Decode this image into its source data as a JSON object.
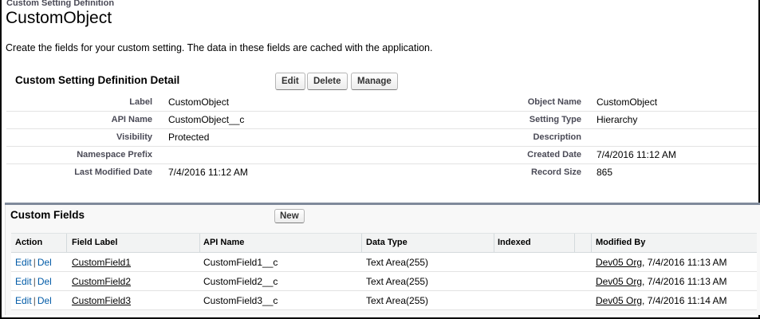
{
  "breadcrumb": "Custom Setting Definition",
  "title": "CustomObject",
  "description": "Create the fields for your custom setting. The data in these fields are cached with the application.",
  "detail": {
    "header": "Custom Setting Definition Detail",
    "buttons": {
      "edit": "Edit",
      "delete": "Delete",
      "manage": "Manage"
    },
    "rows": [
      {
        "label1": "Label",
        "value1": "CustomObject",
        "label2": "Object Name",
        "value2": "CustomObject"
      },
      {
        "label1": "API Name",
        "value1": "CustomObject__c",
        "label2": "Setting Type",
        "value2": "Hierarchy"
      },
      {
        "label1": "Visibility",
        "value1": "Protected",
        "label2": "Description",
        "value2": ""
      },
      {
        "label1": "Namespace Prefix",
        "value1": "",
        "label2": "Created Date",
        "value2": "7/4/2016 11:12 AM"
      },
      {
        "label1": "Last Modified Date",
        "value1": "7/4/2016 11:12 AM",
        "label2": "Record Size",
        "value2": "865"
      }
    ]
  },
  "custom_fields": {
    "header": "Custom Fields",
    "new_button": "New",
    "columns": [
      "Action",
      "Field Label",
      "API Name",
      "Data Type",
      "Indexed",
      "Modified By"
    ],
    "action_edit": "Edit",
    "action_sep": "|",
    "action_del": "Del",
    "rows": [
      {
        "field_label": "CustomField1",
        "api_name": "CustomField1__c",
        "data_type": "Text Area(255)",
        "indexed": "",
        "modified_by_user": "Dev05 Org",
        "modified_by_date": ", 7/4/2016 11:13 AM"
      },
      {
        "field_label": "CustomField2",
        "api_name": "CustomField2__c",
        "data_type": "Text Area(255)",
        "indexed": "",
        "modified_by_user": "Dev05 Org",
        "modified_by_date": ", 7/4/2016 11:13 AM"
      },
      {
        "field_label": "CustomField3",
        "api_name": "CustomField3__c",
        "data_type": "Text Area(255)",
        "indexed": "",
        "modified_by_user": "Dev05 Org",
        "modified_by_date": ", 7/4/2016 11:14 AM"
      }
    ]
  }
}
